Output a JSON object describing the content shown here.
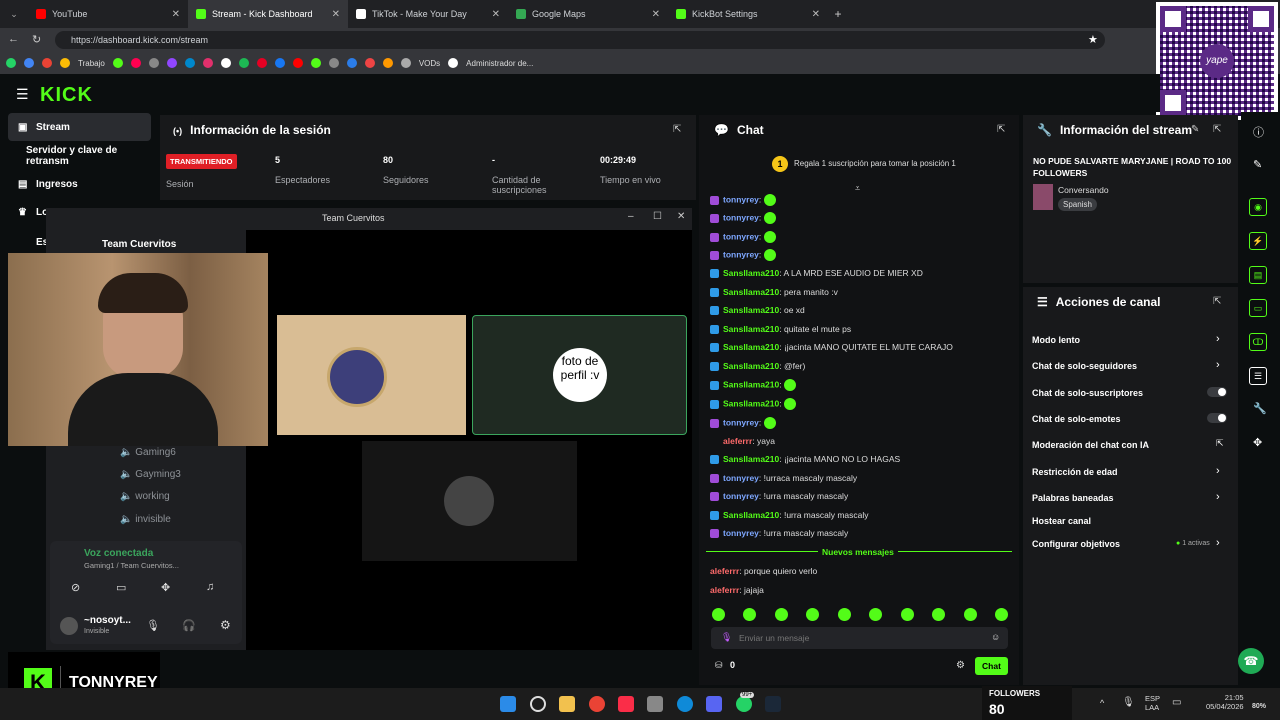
{
  "browser": {
    "tabs": [
      {
        "title": "YouTube",
        "color": "#ff0000"
      },
      {
        "title": "Stream - Kick Dashboard",
        "color": "#53fc18",
        "active": true
      },
      {
        "title": "TikTok - Make Your Day",
        "color": "#ffffff"
      },
      {
        "title": "Google Maps",
        "color": "#34a853"
      },
      {
        "title": "KickBot Settings",
        "color": "#53fc18"
      }
    ],
    "url": "https://dashboard.kick.com/stream",
    "bookmarks": {
      "trabajo": "Trabajo",
      "vods": "VODs",
      "admin": "Administrador de..."
    }
  },
  "kick": {
    "logo": "KICK",
    "sidebar": {
      "items": [
        "Stream",
        "Servidor y clave de retransm",
        "Ingresos",
        "Lo",
        "Es"
      ]
    },
    "session": {
      "title": "Información de la sesión",
      "badge": "TRANSMITIENDO",
      "badge_label": "Sesión",
      "stats": [
        {
          "value": "5",
          "label": "Espectadores"
        },
        {
          "value": "80",
          "label": "Seguidores"
        },
        {
          "value": "-",
          "label": "Cantidad de suscripciones"
        },
        {
          "value": "00:29:49",
          "label": "Tiempo en vivo"
        }
      ]
    },
    "chat": {
      "title": "Chat",
      "promo": "Regala 1 suscripción para tomar la posición 1",
      "promo_num": "1",
      "messages": [
        {
          "user": "tonnyrey",
          "text": "",
          "c": "b"
        },
        {
          "user": "tonnyrey",
          "text": "",
          "c": "b"
        },
        {
          "user": "tonnyrey",
          "text": "",
          "c": "b"
        },
        {
          "user": "tonnyrey",
          "text": "",
          "c": "b"
        },
        {
          "user": "Sansllama210",
          "text": "A LA MRD ESE AUDIO DE MIER XD",
          "c": "g"
        },
        {
          "user": "Sansllama210",
          "text": "pera manito :v",
          "c": "g"
        },
        {
          "user": "Sansllama210",
          "text": "oe xd",
          "c": "g"
        },
        {
          "user": "Sansllama210",
          "text": "quitate el mute ps",
          "c": "g"
        },
        {
          "user": "Sansllama210",
          "text": "¡jacinta MANO QUITATE EL MUTE CARAJO",
          "c": "g"
        },
        {
          "user": "Sansllama210",
          "text": "@fer)",
          "c": "g"
        },
        {
          "user": "Sansllama210",
          "text": "",
          "c": "g"
        },
        {
          "user": "Sansllama210",
          "text": "",
          "c": "g"
        },
        {
          "user": "tonnyrey",
          "text": "",
          "c": "b"
        },
        {
          "user": "aleferrr",
          "text": "yaya",
          "c": "p"
        },
        {
          "user": "Sansllama210",
          "text": "¡jacinta MANO NO LO HAGAS",
          "c": "g"
        },
        {
          "user": "tonnyrey",
          "text": "!urraca mascaly mascaly",
          "c": "b"
        },
        {
          "user": "tonnyrey",
          "text": "!urra mascaly mascaly",
          "c": "b"
        },
        {
          "user": "Sansllama210",
          "text": "!urra mascaly mascaly",
          "c": "g"
        },
        {
          "user": "tonnyrey",
          "text": "!urra mascaly mascaly",
          "c": "b"
        }
      ],
      "new_label": "Nuevos mensajes",
      "new_messages": [
        {
          "user": "aleferrr",
          "text": "porque quiero verlo",
          "c": "p"
        },
        {
          "user": "aleferrr",
          "text": "jajaja",
          "c": "p"
        }
      ],
      "placeholder": "Enviar un mensaje",
      "points": "0",
      "send_label": "Chat"
    },
    "stream_info": {
      "title": "Información del stream",
      "stream_title": "NO PUDE SALVARTE MARYJANE | ROAD TO 100 FOLLOWERS",
      "category": "Conversando",
      "language": "Spanish"
    },
    "actions": {
      "title": "Acciones de canal",
      "items": [
        "Modo lento",
        "Chat de solo-seguidores",
        "Chat de solo-suscriptores",
        "Chat de solo-emotes",
        "Moderación del chat con IA",
        "Restricción de edad",
        "Palabras baneadas",
        "Hostear canal",
        "Configurar objetivos"
      ],
      "goals_active": "1 activas"
    }
  },
  "discord": {
    "title": "Team Cuervitos",
    "server": "Team Cuervitos",
    "channels": [
      "Gaming6",
      "Gayming3",
      "working",
      "invisible"
    ],
    "voice_status": "Voz conectada",
    "voice_channel": "Gaming1 / Team Cuervitos...",
    "user": "~nosoyt...",
    "user_status": "Invisible",
    "tile_text": "foto de perfil :v"
  },
  "overlay": {
    "channel": "TONNYREY"
  },
  "followers_widget": {
    "label": "FOLLOWERS",
    "count": "80"
  },
  "taskbar": {
    "lang": "ESP",
    "layout": "LAA",
    "time": "21:05",
    "date": "05/04/2026",
    "battery": "80%",
    "badge": "99+"
  },
  "qr": {
    "brand": "yape"
  }
}
